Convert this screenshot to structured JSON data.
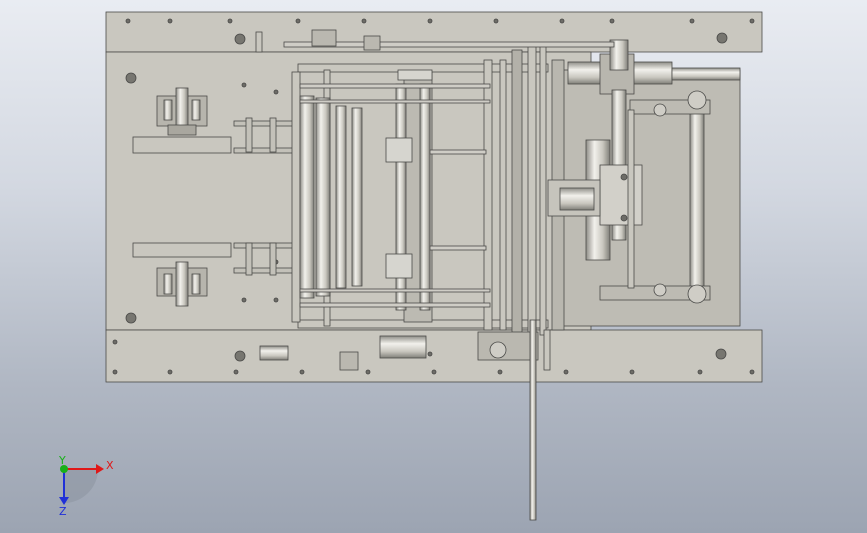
{
  "triad": {
    "x_label": "X",
    "y_label": "Y",
    "z_label": "Z",
    "x_color": "#e01818",
    "y_color": "#18b018",
    "z_color": "#2030d8"
  },
  "model": {
    "plate_color": "#c9c7bf",
    "plate_edge_color": "#4a4a48",
    "roller_color": "#d8d7d2",
    "shadow_color": "#8e8d87"
  }
}
